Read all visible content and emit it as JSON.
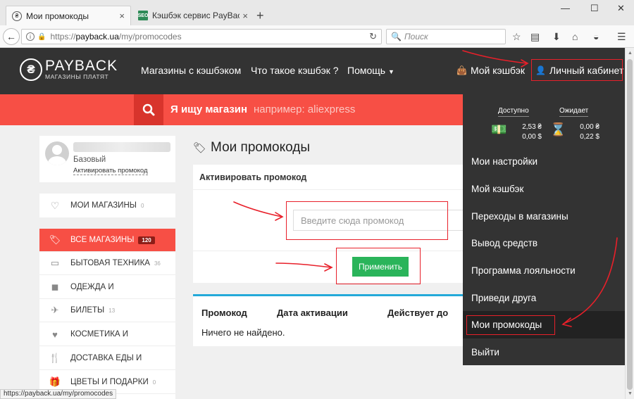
{
  "browser": {
    "tabs": [
      {
        "title": "Мои промокоды",
        "active": true
      },
      {
        "title": "Кэшбэк сервис PayBack - С",
        "active": false
      }
    ],
    "url": {
      "scheme": "https://",
      "host": "payback.ua",
      "path": "/my/promocodes"
    },
    "search_placeholder": "Поиск",
    "status_url": "https://payback.ua/my/promocodes"
  },
  "site": {
    "logo": {
      "brand": "PAYBACK",
      "tagline": "МАГАЗИНЫ ПЛАТЯТ",
      "glyph": "₴"
    },
    "nav": {
      "stores": "Магазины с кэшбэком",
      "what": "Что такое кэшбэк ?",
      "help": "Помощь"
    },
    "my_cashback": "Мой кэшбэк",
    "cabinet": "Личный кабинет",
    "search": {
      "label": "Я ищу магазин",
      "example": "например: aliexpress"
    }
  },
  "profile": {
    "level": "Базовый",
    "activate_link": "Активировать промокод"
  },
  "sidebar": {
    "my_stores": {
      "label": "МОИ МАГАЗИНЫ",
      "count": "0"
    },
    "categories": [
      {
        "label": "ВСЕ МАГАЗИНЫ",
        "count": "120",
        "icon": "tag-icon",
        "glyph": "🏷"
      },
      {
        "label": "БЫТОВАЯ ТЕХНИКА",
        "count": "36",
        "icon": "monitor-icon",
        "glyph": "▭"
      },
      {
        "label": "ОДЕЖДА И",
        "count": "",
        "icon": "bag-icon",
        "glyph": "◼"
      },
      {
        "label": "БИЛЕТЫ",
        "count": "13",
        "icon": "plane-icon",
        "glyph": "✈"
      },
      {
        "label": "КОСМЕТИКА И",
        "count": "",
        "icon": "heart-icon",
        "glyph": "♥"
      },
      {
        "label": "ДОСТАВКА ЕДЫ И",
        "count": "",
        "icon": "fork-knife-icon",
        "glyph": "🍴"
      },
      {
        "label": "ЦВЕТЫ И ПОДАРКИ",
        "count": "0",
        "icon": "gift-icon",
        "glyph": "🎁"
      }
    ]
  },
  "main": {
    "title": "Мои промокоды",
    "activate_header": "Активировать промокод",
    "input_placeholder": "Введите сюда промокод",
    "apply_label": "Применить",
    "table": {
      "headers": [
        "Промокод",
        "Дата активации",
        "Действует до"
      ],
      "empty": "Ничего не найдено."
    }
  },
  "dropdown": {
    "available": {
      "label": "Доступно",
      "uah": "2,53 ₴",
      "usd": "0,00 $"
    },
    "pending": {
      "label": "Ожидает",
      "uah": "0,00 ₴",
      "usd": "0,22 $"
    },
    "items": [
      {
        "label": "Мои настройки"
      },
      {
        "label": "Мой кэшбэк"
      },
      {
        "label": "Переходы в магазины"
      },
      {
        "label": "Вывод средств"
      },
      {
        "label": "Программа лояльности"
      },
      {
        "label": "Приведи друга"
      },
      {
        "label": "Мои промокоды",
        "current": true
      },
      {
        "label": "Выйти"
      }
    ]
  },
  "colors": {
    "header": "#333333",
    "accent_red": "#f74f45",
    "button_green": "#2ab45a",
    "table_border": "#23a9d9",
    "annotation": "#e8202a"
  }
}
